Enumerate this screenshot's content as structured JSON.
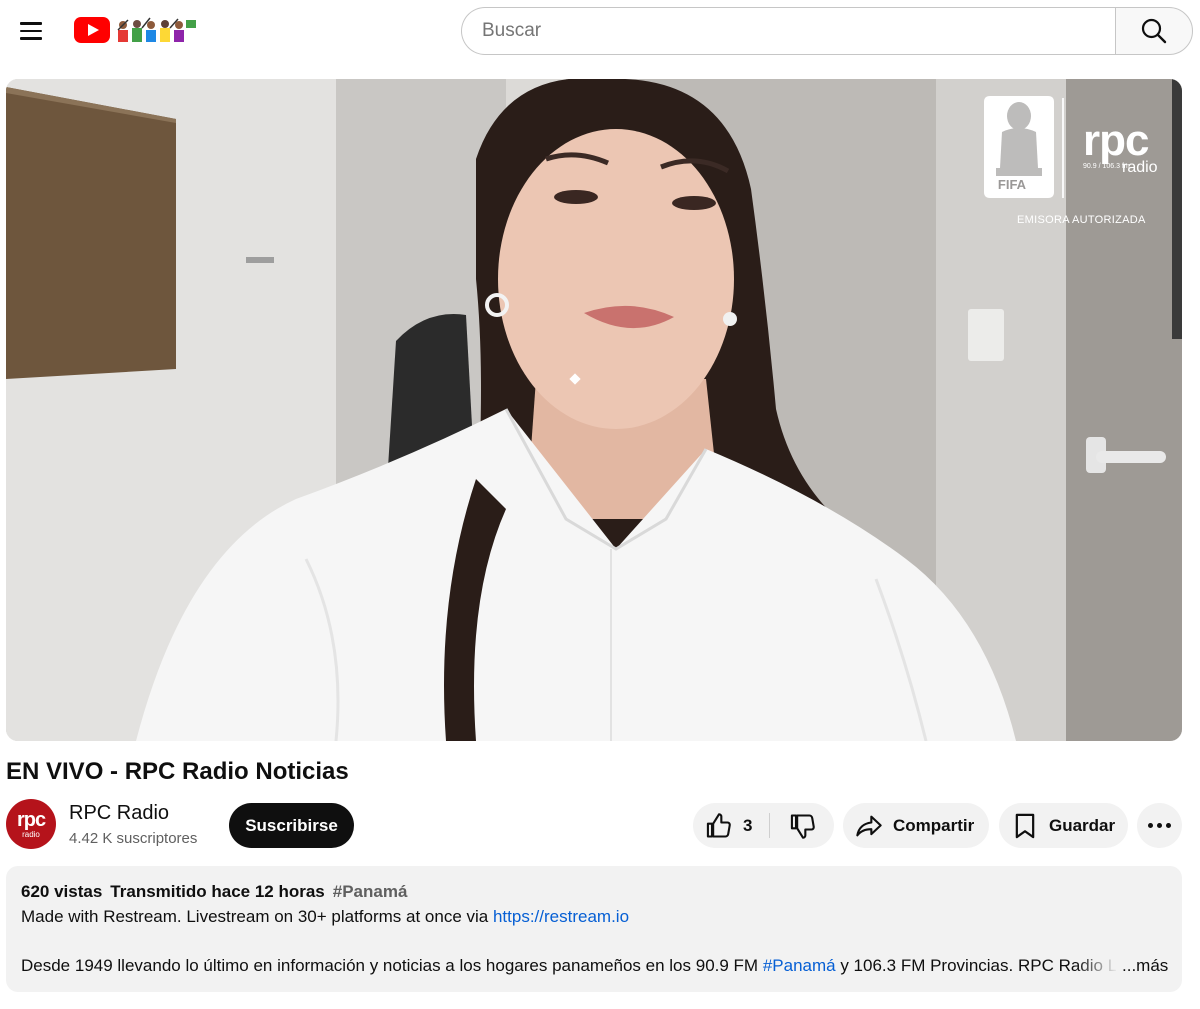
{
  "header": {
    "search_placeholder": "Buscar"
  },
  "video": {
    "overlay": {
      "fifa_label": "FIFA",
      "brand": "rpc",
      "brand_sub": "90.9 / 106.3 fm",
      "brand_radio": "radio",
      "authorized": "EMISORA AUTORIZADA"
    },
    "title": "EN VIVO - RPC Radio Noticias"
  },
  "channel": {
    "avatar_text": "rpc",
    "avatar_sub": "radio",
    "name": "RPC Radio",
    "subscribers": "4.42 K suscriptores",
    "subscribe_label": "Suscribirse"
  },
  "actions": {
    "like_count": "3",
    "share_label": "Compartir",
    "save_label": "Guardar"
  },
  "description": {
    "views": "620 vistas",
    "streamed": "Transmitido hace 12 horas",
    "hashtag": "#Panamá",
    "line1_text": "Made with Restream. Livestream on 30+ platforms at once via ",
    "line1_link": "https://restream.io",
    "line2_a": "Desde 1949 llevando lo último en información y noticias a los hogares panameños en los 90.9 FM ",
    "line2_hashtag": "#Panamá",
    "line2_b": " y 106.3 FM Provincias. RPC Radio L",
    "more_label": "...más"
  },
  "colors": {
    "brand_red": "#ff0000",
    "subscribe_bg": "#0f0f0f",
    "link": "#065fd4",
    "pill_bg": "#f2f2f2",
    "channel_avatar": "#b5131b"
  }
}
